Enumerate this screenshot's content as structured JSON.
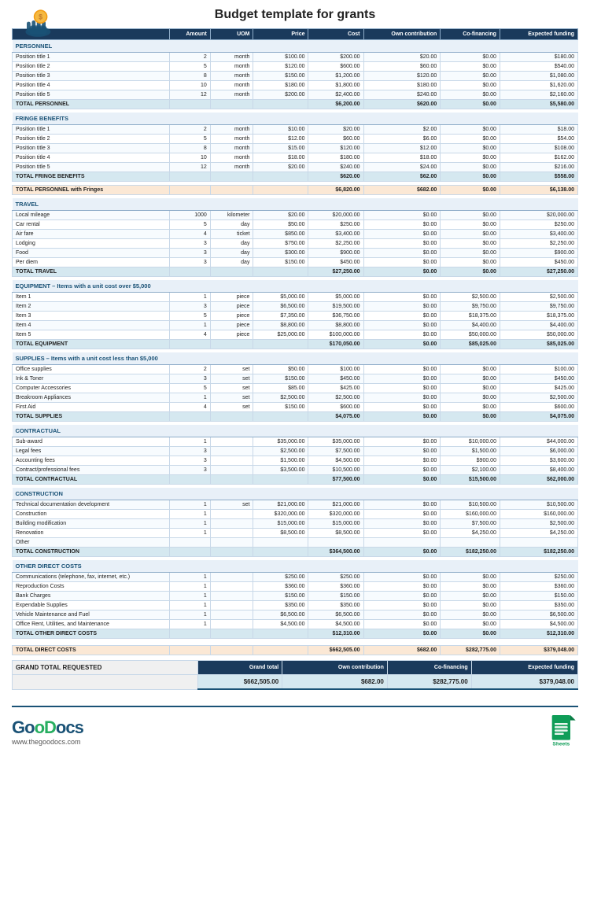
{
  "header": {
    "title": "Budget template for grants"
  },
  "col_headers": [
    "Amount",
    "UOM",
    "Price",
    "Cost",
    "Own contribution",
    "Co-financing",
    "Expected funding"
  ],
  "sections": {
    "personnel": {
      "label": "PERSONNEL",
      "rows": [
        [
          "Position title 1",
          "2",
          "month",
          "$100.00",
          "$200.00",
          "$20.00",
          "$0.00",
          "$180.00"
        ],
        [
          "Position title 2",
          "5",
          "month",
          "$120.00",
          "$600.00",
          "$60.00",
          "$0.00",
          "$540.00"
        ],
        [
          "Position title 3",
          "8",
          "month",
          "$150.00",
          "$1,200.00",
          "$120.00",
          "$0.00",
          "$1,080.00"
        ],
        [
          "Position title 4",
          "10",
          "month",
          "$180.00",
          "$1,800.00",
          "$180.00",
          "$0.00",
          "$1,620.00"
        ],
        [
          "Position title 5",
          "12",
          "month",
          "$200.00",
          "$2,400.00",
          "$240.00",
          "$0.00",
          "$2,160.00"
        ]
      ],
      "total_label": "TOTAL PERSONNEL",
      "total": [
        "",
        "",
        "",
        "$6,200.00",
        "$620.00",
        "$0.00",
        "$5,580.00"
      ]
    },
    "fringe": {
      "label": "FRINGE BENEFITS",
      "rows": [
        [
          "Position title 1",
          "2",
          "month",
          "$10.00",
          "$20.00",
          "$2.00",
          "$0.00",
          "$18.00"
        ],
        [
          "Position title 2",
          "5",
          "month",
          "$12.00",
          "$60.00",
          "$6.00",
          "$0.00",
          "$54.00"
        ],
        [
          "Position title 3",
          "8",
          "month",
          "$15.00",
          "$120.00",
          "$12.00",
          "$0.00",
          "$108.00"
        ],
        [
          "Position title 4",
          "10",
          "month",
          "$18.00",
          "$180.00",
          "$18.00",
          "$0.00",
          "$162.00"
        ],
        [
          "Position title 5",
          "12",
          "month",
          "$20.00",
          "$240.00",
          "$24.00",
          "$0.00",
          "$216.00"
        ]
      ],
      "total_label": "TOTAL FRINGE BENEFITS",
      "total": [
        "",
        "",
        "",
        "$620.00",
        "$62.00",
        "$0.00",
        "$558.00"
      ]
    },
    "personnel_fringe": {
      "label": "TOTAL PERSONNEL with Fringes",
      "total": [
        "",
        "",
        "",
        "$6,820.00",
        "$682.00",
        "$0.00",
        "$6,138.00"
      ]
    },
    "travel": {
      "label": "TRAVEL",
      "rows": [
        [
          "Local mileage",
          "1000",
          "kilometer",
          "$20.00",
          "$20,000.00",
          "$0.00",
          "$0.00",
          "$20,000.00"
        ],
        [
          "Car rental",
          "5",
          "day",
          "$50.00",
          "$250.00",
          "$0.00",
          "$0.00",
          "$250.00"
        ],
        [
          "Air fare",
          "4",
          "ticket",
          "$850.00",
          "$3,400.00",
          "$0.00",
          "$0.00",
          "$3,400.00"
        ],
        [
          "Lodging",
          "3",
          "day",
          "$750.00",
          "$2,250.00",
          "$0.00",
          "$0.00",
          "$2,250.00"
        ],
        [
          "Food",
          "3",
          "day",
          "$300.00",
          "$900.00",
          "$0.00",
          "$0.00",
          "$900.00"
        ],
        [
          "Per diem",
          "3",
          "day",
          "$150.00",
          "$450.00",
          "$0.00",
          "$0.00",
          "$450.00"
        ]
      ],
      "total_label": "TOTAL TRAVEL",
      "total": [
        "",
        "",
        "",
        "$27,250.00",
        "$0.00",
        "$0.00",
        "$27,250.00"
      ]
    },
    "equipment": {
      "label": "EQUIPMENT – Items with a unit cost over $5,000",
      "rows": [
        [
          "Item 1",
          "1",
          "piece",
          "$5,000.00",
          "$5,000.00",
          "$0.00",
          "$2,500.00",
          "$2,500.00"
        ],
        [
          "Item 2",
          "3",
          "piece",
          "$6,500.00",
          "$19,500.00",
          "$0.00",
          "$9,750.00",
          "$9,750.00"
        ],
        [
          "Item 3",
          "5",
          "piece",
          "$7,350.00",
          "$36,750.00",
          "$0.00",
          "$18,375.00",
          "$18,375.00"
        ],
        [
          "Item 4",
          "1",
          "piece",
          "$8,800.00",
          "$8,800.00",
          "$0.00",
          "$4,400.00",
          "$4,400.00"
        ],
        [
          "Item 5",
          "4",
          "piece",
          "$25,000.00",
          "$100,000.00",
          "$0.00",
          "$50,000.00",
          "$50,000.00"
        ]
      ],
      "total_label": "TOTAL EQUIPMENT",
      "total": [
        "",
        "",
        "",
        "$170,050.00",
        "$0.00",
        "$85,025.00",
        "$85,025.00"
      ]
    },
    "supplies": {
      "label": "SUPPLIES – Items with a unit cost less than $5,000",
      "rows": [
        [
          "Office supplies",
          "2",
          "set",
          "$50.00",
          "$100.00",
          "$0.00",
          "$0.00",
          "$100.00"
        ],
        [
          "Ink & Toner",
          "3",
          "set",
          "$150.00",
          "$450.00",
          "$0.00",
          "$0.00",
          "$450.00"
        ],
        [
          "Computer Accessories",
          "5",
          "set",
          "$85.00",
          "$425.00",
          "$0.00",
          "$0.00",
          "$425.00"
        ],
        [
          "Breakroom Appliances",
          "1",
          "set",
          "$2,500.00",
          "$2,500.00",
          "$0.00",
          "$0.00",
          "$2,500.00"
        ],
        [
          "First Aid",
          "4",
          "set",
          "$150.00",
          "$600.00",
          "$0.00",
          "$0.00",
          "$600.00"
        ]
      ],
      "total_label": "TOTAL SUPPLIES",
      "total": [
        "",
        "",
        "",
        "$4,075.00",
        "$0.00",
        "$0.00",
        "$4,075.00"
      ]
    },
    "contractual": {
      "label": "CONTRACTUAL",
      "rows": [
        [
          "Sub-award",
          "1",
          "",
          "$35,000.00",
          "$35,000.00",
          "$0.00",
          "$10,000.00",
          "$44,000.00"
        ],
        [
          "Legal fees",
          "3",
          "",
          "$2,500.00",
          "$7,500.00",
          "$0.00",
          "$1,500.00",
          "$6,000.00"
        ],
        [
          "Accounting fees",
          "3",
          "",
          "$1,500.00",
          "$4,500.00",
          "$0.00",
          "$900.00",
          "$3,600.00"
        ],
        [
          "Contract/professional fees",
          "3",
          "",
          "$3,500.00",
          "$10,500.00",
          "$0.00",
          "$2,100.00",
          "$8,400.00"
        ]
      ],
      "total_label": "TOTAL CONTRACTUAL",
      "total": [
        "",
        "",
        "",
        "$77,500.00",
        "$0.00",
        "$15,500.00",
        "$62,000.00"
      ]
    },
    "construction": {
      "label": "CONSTRUCTION",
      "rows": [
        [
          "Technical documentation development",
          "1",
          "set",
          "$21,000.00",
          "$21,000.00",
          "$0.00",
          "$10,500.00",
          "$10,500.00"
        ],
        [
          "Construction",
          "1",
          "",
          "$320,000.00",
          "$320,000.00",
          "$0.00",
          "$160,000.00",
          "$160,000.00"
        ],
        [
          "Building modification",
          "1",
          "",
          "$15,000.00",
          "$15,000.00",
          "$0.00",
          "$7,500.00",
          "$2,500.00"
        ],
        [
          "Renovation",
          "1",
          "",
          "$8,500.00",
          "$8,500.00",
          "$0.00",
          "$4,250.00",
          "$4,250.00"
        ],
        [
          "Other",
          "",
          "",
          "",
          "",
          "",
          "",
          ""
        ]
      ],
      "total_label": "TOTAL CONSTRUCTION",
      "total": [
        "",
        "",
        "",
        "$364,500.00",
        "$0.00",
        "$182,250.00",
        "$182,250.00"
      ]
    },
    "other_direct": {
      "label": "OTHER DIRECT COSTS",
      "rows": [
        [
          "Communications (telephone, fax, internet, etc.)",
          "1",
          "",
          "$250.00",
          "$250.00",
          "$0.00",
          "$0.00",
          "$250.00"
        ],
        [
          "Reproduction Costs",
          "1",
          "",
          "$360.00",
          "$360.00",
          "$0.00",
          "$0.00",
          "$360.00"
        ],
        [
          "Bank Charges",
          "1",
          "",
          "$150.00",
          "$150.00",
          "$0.00",
          "$0.00",
          "$150.00"
        ],
        [
          "Expendable Supplies",
          "1",
          "",
          "$350.00",
          "$350.00",
          "$0.00",
          "$0.00",
          "$350.00"
        ],
        [
          "Vehicle Maintenance and Fuel",
          "1",
          "",
          "$6,500.00",
          "$6,500.00",
          "$0.00",
          "$0.00",
          "$6,500.00"
        ],
        [
          "Office Rent, Utilities, and Maintenance",
          "1",
          "",
          "$4,500.00",
          "$4,500.00",
          "$0.00",
          "$0.00",
          "$4,500.00"
        ]
      ],
      "total_label": "TOTAL OTHER DIRECT COSTS",
      "total": [
        "",
        "",
        "",
        "$12,310.00",
        "$0.00",
        "$0.00",
        "$12,310.00"
      ]
    },
    "total_direct": {
      "label": "TOTAL DIRECT COSTS",
      "total": [
        "",
        "",
        "",
        "$662,505.00",
        "$682.00",
        "$282,775.00",
        "$379,048.00"
      ]
    },
    "grand_total": {
      "label": "GRAND TOTAL REQUESTED",
      "header_cols": [
        "Grand total",
        "Own contribution",
        "Co-financing",
        "Expected funding"
      ],
      "values": [
        "$662,505.00",
        "$682.00",
        "$282,775.00",
        "$379,048.00"
      ]
    }
  },
  "footer": {
    "logo_text": "GooDocs",
    "website": "www.thegoodocs.com",
    "app": "Sheets"
  }
}
